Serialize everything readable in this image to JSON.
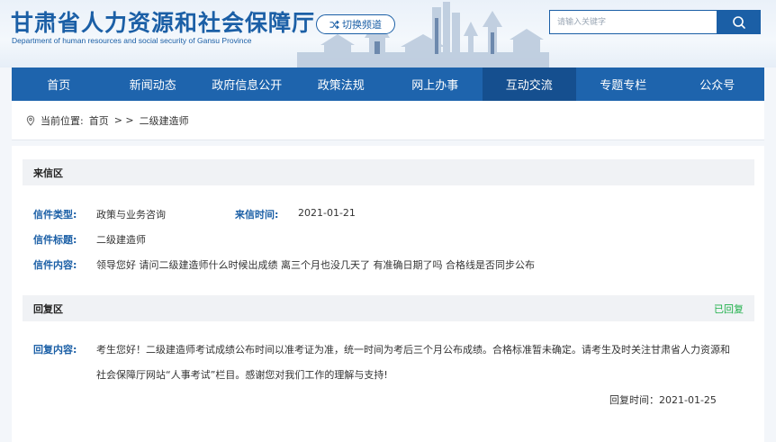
{
  "header": {
    "title": "甘肃省人力资源和社会保障厅",
    "subtitle": "Department of human resources and social security of Gansu Province",
    "switch_label": "切换频道",
    "search_placeholder": "请输入关键字",
    "colors": {
      "brand": "#1b5fa6",
      "nav": "#1e64ad",
      "nav_active": "#154f8f",
      "status": "#1fb04a"
    }
  },
  "nav": {
    "items": [
      {
        "label": "首页"
      },
      {
        "label": "新闻动态"
      },
      {
        "label": "政府信息公开"
      },
      {
        "label": "政策法规"
      },
      {
        "label": "网上办事"
      },
      {
        "label": "互动交流"
      },
      {
        "label": "专题专栏"
      },
      {
        "label": "公众号"
      }
    ],
    "active_index": 5
  },
  "breadcrumb": {
    "prefix": "当前位置:",
    "home": "首页",
    "separator": "> >",
    "current": "二级建造师"
  },
  "letter": {
    "section_title": "来信区",
    "type_label": "信件类型:",
    "type_value": "政策与业务咨询",
    "time_label": "来信时间:",
    "time_value": "2021-01-21",
    "subject_label": "信件标题:",
    "subject_value": "二级建造师",
    "content_label": "信件内容:",
    "content_value": "领导您好 请问二级建造师什么时候出成绩 离三个月也没几天了 有准确日期了吗 合格线是否同步公布"
  },
  "reply": {
    "section_title": "回复区",
    "status": "已回复",
    "content_label": "回复内容:",
    "content_line1": "考生您好！二级建造师考试成绩公布时间以准考证为准，统一时间为考后三个月公布成绩。合格标准暂未确定。请考生及时关注甘肃省人力资源和",
    "content_line2": "社会保障厅网站“人事考试”栏目。感谢您对我们工作的理解与支持!",
    "time": "回复时间：2021-01-25"
  }
}
